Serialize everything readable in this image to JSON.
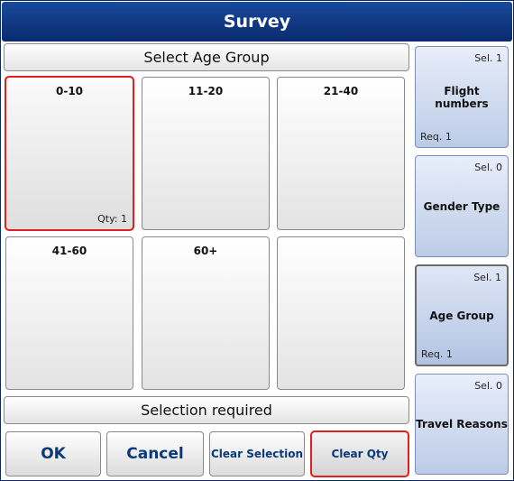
{
  "window": {
    "title": "Survey"
  },
  "header": {
    "label": "Select Age Group"
  },
  "tiles": [
    {
      "label": "0-10",
      "qty": "Qty: 1"
    },
    {
      "label": "11-20",
      "qty": ""
    },
    {
      "label": "21-40",
      "qty": ""
    },
    {
      "label": "41-60",
      "qty": ""
    },
    {
      "label": "60+",
      "qty": ""
    },
    {
      "label": "",
      "qty": ""
    }
  ],
  "status": {
    "label": "Selection required"
  },
  "buttons": {
    "ok": "OK",
    "cancel": "Cancel",
    "clear_selection": "Clear Selection",
    "clear_qty": "Clear Qty"
  },
  "sidebar": [
    {
      "sel": "Sel. 1",
      "title": "Flight numbers",
      "req": "Req. 1"
    },
    {
      "sel": "Sel. 0",
      "title": "Gender Type",
      "req": ""
    },
    {
      "sel": "Sel. 1",
      "title": "Age Group",
      "req": "Req. 1"
    },
    {
      "sel": "Sel. 0",
      "title": "Travel Reasons",
      "req": ""
    }
  ],
  "colors": {
    "titlebar": "#0a2a70",
    "button_text": "#0a3a7a",
    "selection_outline": "#e02020",
    "sidebar_bg": "#bccbe6"
  }
}
